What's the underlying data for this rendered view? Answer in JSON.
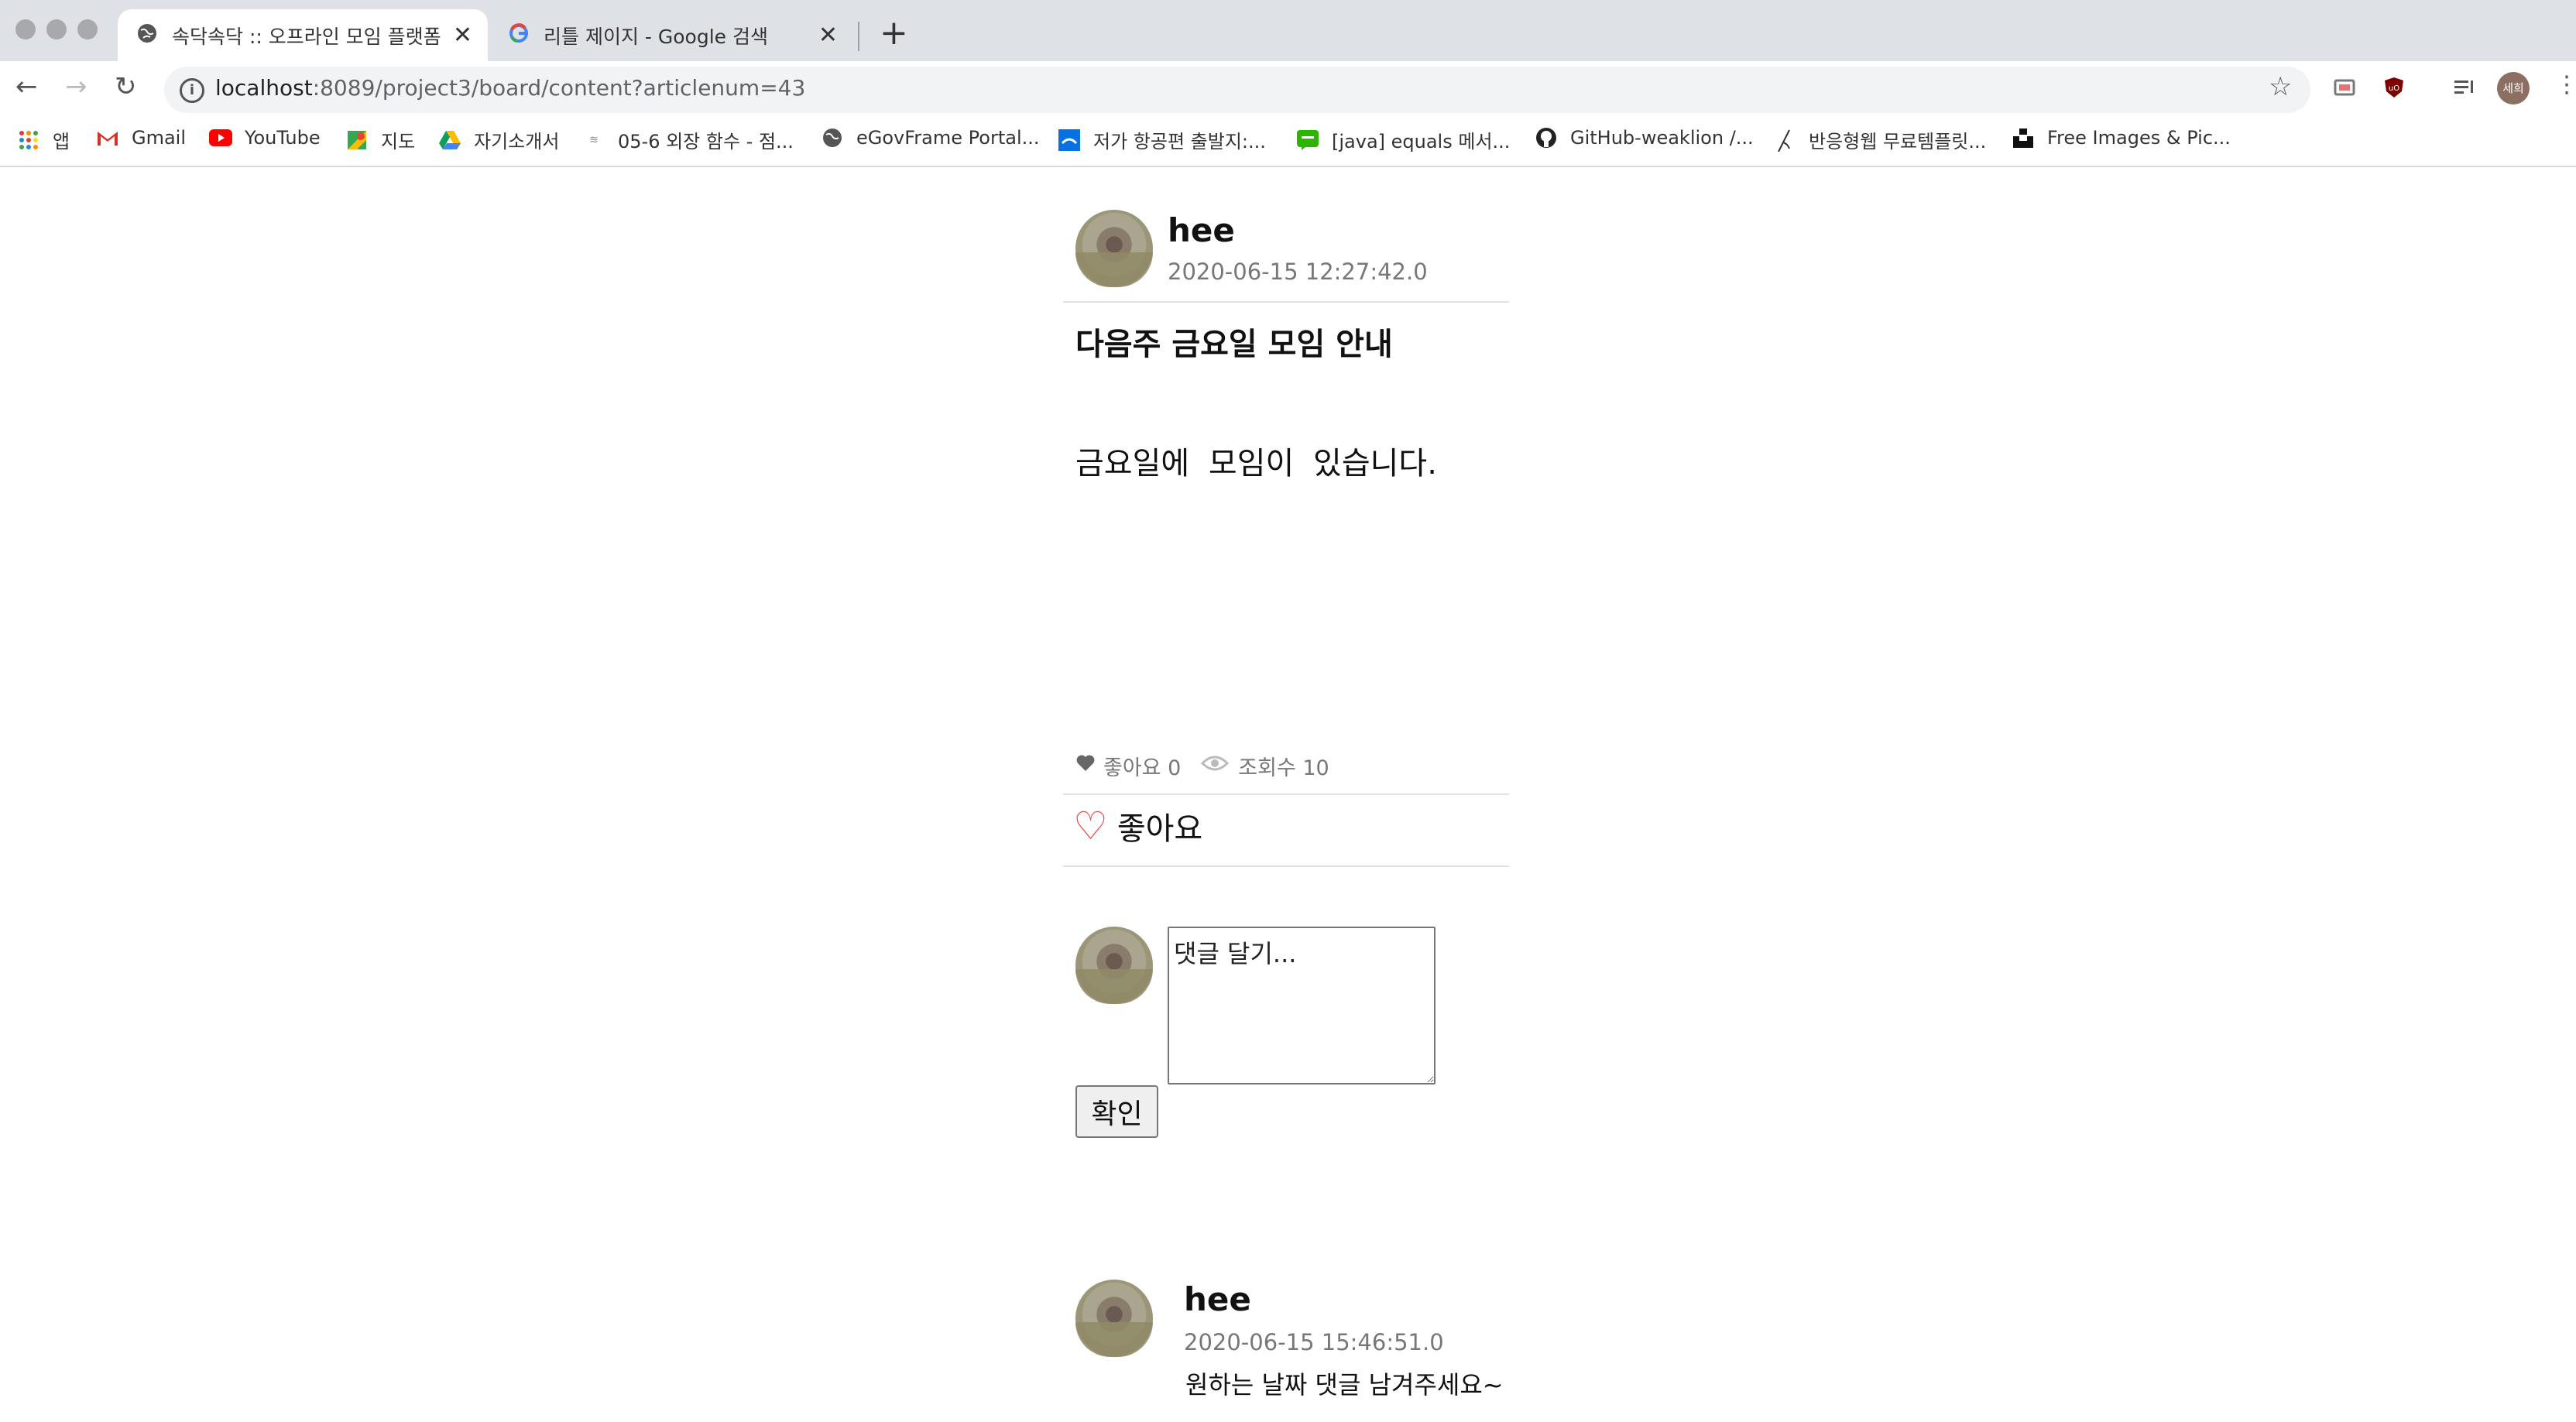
{
  "browser": {
    "tabs": [
      {
        "title": "속닥속닥 :: 오프라인 모임 플랫폼",
        "icon": "globe-icon",
        "active": true
      },
      {
        "title": "리틀 제이지 - Google 검색",
        "icon": "google-icon",
        "active": false
      }
    ],
    "address": {
      "host": "localhost",
      "path": ":8089/project3/board/content?articlenum=43"
    },
    "profile_initials": "세희",
    "bookmarks": [
      {
        "label": "앱",
        "icon": "apps-grid-icon"
      },
      {
        "label": "Gmail",
        "icon": "gmail-icon"
      },
      {
        "label": "YouTube",
        "icon": "youtube-icon"
      },
      {
        "label": "지도",
        "icon": "maps-icon"
      },
      {
        "label": "자기소개서",
        "icon": "drive-icon"
      },
      {
        "label": "05-6 외장 함수 - 점...",
        "icon": "wikidocs-icon"
      },
      {
        "label": "eGovFrame Portal...",
        "icon": "globe-icon"
      },
      {
        "label": "저가 항공편 출발지:...",
        "icon": "skyscanner-icon"
      },
      {
        "label": "[java] equals 메서...",
        "icon": "naver-icon"
      },
      {
        "label": "GitHub-weaklion /...",
        "icon": "github-icon"
      },
      {
        "label": "반응형웹 무료템플릿...",
        "icon": "pen-icon"
      },
      {
        "label": "Free Images & Pic...",
        "icon": "unsplash-icon"
      }
    ]
  },
  "post": {
    "author": "hee",
    "date": "2020-06-15 12:27:42.0",
    "title": "다음주 금요일 모임 안내",
    "content": "금요일에 모임이 있습니다.",
    "likes_label": "좋아요 0",
    "views_label": "조회수 10",
    "like_button_label": "좋아요"
  },
  "comment_form": {
    "placeholder": "댓글 달기...",
    "submit_label": "확인"
  },
  "comments": [
    {
      "author": "hee",
      "date": "2020-06-15 15:46:51.0",
      "text": "원하는 날짜 댓글 남겨주세요~"
    }
  ],
  "colors": {
    "like_heart": "#e74c4c",
    "muted_text": "#777777",
    "divider": "#e1e1e1"
  }
}
